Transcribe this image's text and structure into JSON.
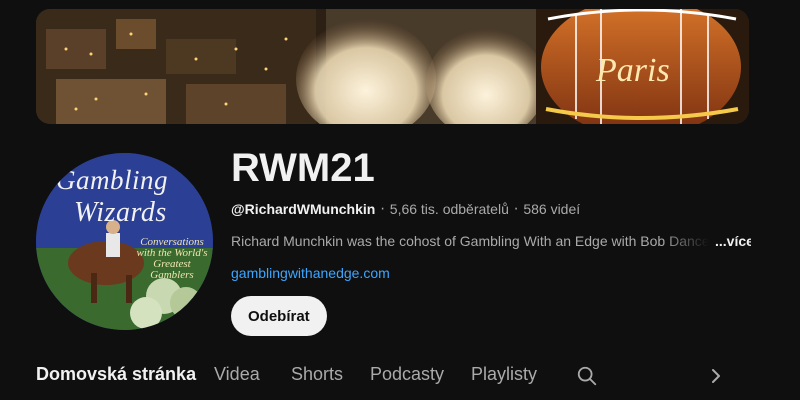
{
  "channel": {
    "name": "RWM21",
    "handle": "@RichardWMunchkin",
    "subscribers": "5,66 tis. odběratelů",
    "videos": "586 videí",
    "description": "Richard Munchkin was the cohost of Gambling With an Edge with Bob Dancer for",
    "more_label": "...více",
    "link": "gamblingwithanedge.com",
    "subscribe_label": "Odebírat"
  },
  "avatar": {
    "line1": "Gambling",
    "line2": "Wizards",
    "line3": "Conversations with the World's Greatest Gamblers"
  },
  "banner": {
    "sign_text": "Paris"
  },
  "tabs": [
    {
      "label": "Domovská stránka",
      "active": true
    },
    {
      "label": "Videa",
      "active": false
    },
    {
      "label": "Shorts",
      "active": false
    },
    {
      "label": "Podcasty",
      "active": false
    },
    {
      "label": "Playlisty",
      "active": false
    }
  ],
  "icons": {
    "search": "search-icon",
    "next": "chevron-right-icon"
  },
  "colors": {
    "background": "#0f0f0f",
    "link": "#3ea6ff",
    "subscribe_bg": "#f1f1f1"
  }
}
